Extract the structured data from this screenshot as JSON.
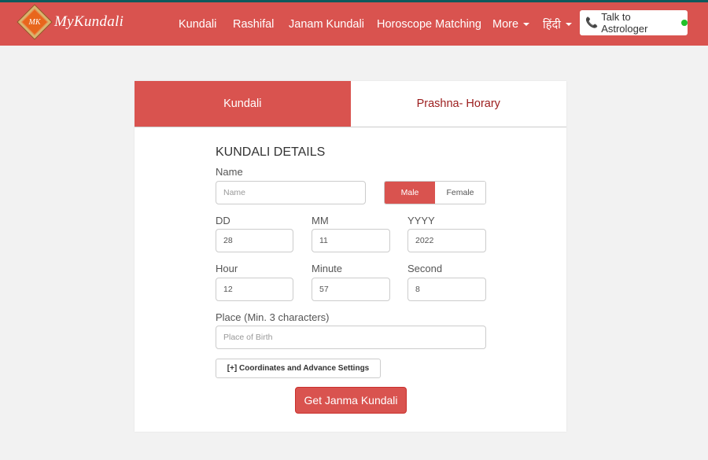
{
  "colors": {
    "brand_red": "#d9534f",
    "top_stripe": "#0e5a5c",
    "inactive_tab_text": "#9b1c1c",
    "online_dot": "#22c02a"
  },
  "header": {
    "logo_initials": "MK",
    "brand_name": "MyKundali",
    "nav": [
      {
        "label": "Kundali"
      },
      {
        "label": "Rashifal"
      },
      {
        "label": "Janam Kundali"
      },
      {
        "label": "Horoscope Matching"
      },
      {
        "label": "More"
      },
      {
        "label": "हिंदी"
      }
    ],
    "talk_button": {
      "icon": "phone-icon",
      "label": "Talk to Astrologer",
      "status": "online"
    }
  },
  "tabs": [
    {
      "label": "Kundali",
      "active": true
    },
    {
      "label": "Prashna- Horary",
      "active": false
    }
  ],
  "form": {
    "title": "KUNDALI DETAILS",
    "name": {
      "label": "Name",
      "placeholder": "Name",
      "value": ""
    },
    "gender": {
      "options": [
        "Male",
        "Female"
      ],
      "selected": "Male"
    },
    "dd": {
      "label": "DD",
      "value": "28"
    },
    "mm": {
      "label": "MM",
      "value": "11"
    },
    "yyyy": {
      "label": "YYYY",
      "value": "2022"
    },
    "hour": {
      "label": "Hour",
      "value": "12"
    },
    "minute": {
      "label": "Minute",
      "value": "57"
    },
    "second": {
      "label": "Second",
      "value": "8"
    },
    "place": {
      "label": "Place (Min. 3 characters)",
      "placeholder": "Place of Birth",
      "value": ""
    },
    "advance_button": "[+] Coordinates and Advance Settings",
    "submit_button": "Get Janma Kundali"
  }
}
